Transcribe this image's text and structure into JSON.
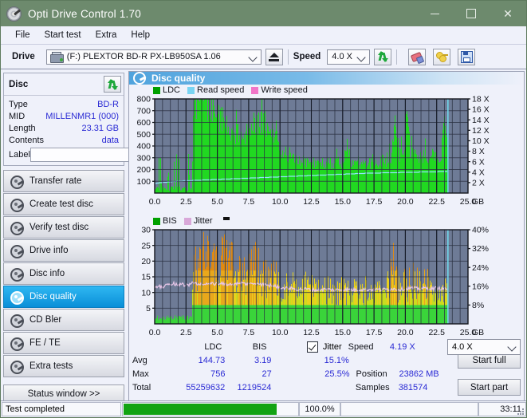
{
  "window": {
    "title": "Opti Drive Control 1.70",
    "icon": "disc-pen-icon",
    "minimize": "minimize-icon",
    "maximize": "maximize-icon",
    "close": "close-icon"
  },
  "menu": [
    "File",
    "Start test",
    "Extra",
    "Help"
  ],
  "toolbar": {
    "drive_label": "Drive",
    "drive_value": "(F:)  PLEXTOR BD-R  PX-LB950SA 1.06",
    "eject_icon": "eject-icon",
    "speed_label": "Speed",
    "speed_value": "4.0 X",
    "refresh_icon": "refresh-arrows-icon",
    "erase_icon": "eraser-icon",
    "keys_icon": "keys-icon",
    "save_icon": "save-floppy-icon"
  },
  "disc": {
    "title": "Disc",
    "refresh_icon": "refresh-arrows-icon",
    "rows": [
      {
        "key": "Type",
        "value": "BD-R"
      },
      {
        "key": "MID",
        "value": "MILLENMR1 (000)"
      },
      {
        "key": "Length",
        "value": "23.31 GB"
      },
      {
        "key": "Contents",
        "value": "data"
      }
    ],
    "label_key": "Label",
    "label_value": "",
    "label_placeholder": "",
    "label_icon": "cd-icon"
  },
  "nav": {
    "items": [
      {
        "label": "Transfer rate",
        "selected": false
      },
      {
        "label": "Create test disc",
        "selected": false
      },
      {
        "label": "Verify test disc",
        "selected": false
      },
      {
        "label": "Drive info",
        "selected": false
      },
      {
        "label": "Disc info",
        "selected": false
      },
      {
        "label": "Disc quality",
        "selected": true
      },
      {
        "label": "CD Bler",
        "selected": false
      },
      {
        "label": "FE / TE",
        "selected": false
      },
      {
        "label": "Extra tests",
        "selected": false
      }
    ],
    "status_window": "Status window >>"
  },
  "panel": {
    "title": "Disc quality",
    "icon": "disc-quality-icon"
  },
  "stats": {
    "col_ldc": "LDC",
    "col_bis": "BIS",
    "jitter_label": "Jitter",
    "jitter_checked": true,
    "rows": [
      {
        "label": "Avg",
        "ldc": "144.73",
        "bis": "3.19",
        "jitter": "15.1%"
      },
      {
        "label": "Max",
        "ldc": "756",
        "bis": "27",
        "jitter": "25.5%"
      },
      {
        "label": "Total",
        "ldc": "55259632",
        "bis": "1219524",
        "jitter": ""
      }
    ],
    "speed_key": "Speed",
    "speed_val": "4.19 X",
    "position_key": "Position",
    "position_val": "23862 MB",
    "samples_key": "Samples",
    "samples_val": "381574",
    "speed_select": "4.0 X",
    "start_full": "Start full",
    "start_part": "Start part"
  },
  "statusbar": {
    "message": "Test completed",
    "percent": "100.0%",
    "elapsed": "33:11"
  },
  "colors": {
    "ldc_green": "#21d821",
    "read_speed": "#79e0f2",
    "write_speed": "#f075c8",
    "bis_green": "#21d821",
    "jitter_pink": "#e0b8e0",
    "plot_bg": "#6e7b96",
    "grid": "#2a3142",
    "accent_blue": "#2a2ad4",
    "titlebar": "#6d8a6d",
    "selected": "#0a8fd8",
    "progress": "#12a312"
  },
  "chart_data": [
    {
      "type": "area",
      "title": "Disc quality - LDC / Read speed / Write speed",
      "xlabel": "GB",
      "ylabel": "LDC",
      "xlim": [
        0.0,
        25.0
      ],
      "ylim": [
        0,
        800
      ],
      "xticks": [
        "0.0",
        "2.5",
        "5.0",
        "7.5",
        "10.0",
        "12.5",
        "15.0",
        "17.5",
        "20.0",
        "22.5",
        "25.0"
      ],
      "yticks": [
        "100",
        "200",
        "300",
        "400",
        "500",
        "600",
        "700",
        "800"
      ],
      "y2label": "X",
      "y2lim": [
        0,
        18
      ],
      "y2ticks": [
        "2 X",
        "4 X",
        "6 X",
        "8 X",
        "10 X",
        "12 X",
        "14 X",
        "16 X",
        "18 X"
      ],
      "grid": true,
      "legend": [
        {
          "name": "LDC",
          "color": "#00a000"
        },
        {
          "name": "Read speed",
          "color": "#79d4f2"
        },
        {
          "name": "Write speed",
          "color": "#f075c8"
        }
      ],
      "data_end_gb": 23.4,
      "series": [
        {
          "name": "LDC",
          "color": "#21d821",
          "x": [
            0.0,
            0.15,
            0.3,
            0.5,
            0.7,
            0.9,
            1.1,
            1.3,
            1.5,
            1.7,
            1.9,
            2.1,
            2.3,
            2.5,
            2.7,
            2.9,
            3.05,
            3.2,
            3.4,
            3.6,
            3.8,
            4.0,
            4.2,
            4.4,
            4.6,
            4.8,
            5.0,
            5.2,
            5.4,
            5.6,
            5.8,
            6.0,
            6.2,
            6.4,
            6.6,
            6.8,
            7.0,
            7.2,
            7.5,
            7.8,
            8.1,
            8.4,
            8.7,
            9.0,
            9.3,
            9.6,
            9.9,
            10.2,
            10.5,
            10.8,
            11.1,
            11.4,
            11.7,
            12.0,
            12.3,
            12.6,
            12.9,
            13.2,
            13.5,
            13.8,
            14.1,
            14.4,
            14.7,
            15.0,
            15.3,
            15.6,
            15.9,
            16.2,
            16.5,
            16.8,
            17.1,
            17.4,
            17.7,
            18.0,
            18.3,
            18.6,
            18.9,
            19.2,
            19.5,
            19.8,
            20.1,
            20.4,
            20.7,
            21.0,
            21.3,
            21.6,
            21.9,
            22.2,
            22.5,
            22.8,
            23.1,
            23.4
          ],
          "values": [
            60,
            300,
            90,
            70,
            70,
            160,
            150,
            60,
            300,
            60,
            50,
            50,
            50,
            60,
            200,
            520,
            700,
            740,
            700,
            720,
            690,
            760,
            700,
            740,
            660,
            600,
            620,
            560,
            600,
            480,
            560,
            520,
            480,
            440,
            460,
            420,
            440,
            480,
            560,
            580,
            540,
            600,
            550,
            560,
            520,
            440,
            400,
            340,
            310,
            300,
            290,
            270,
            260,
            250,
            240,
            250,
            240,
            250,
            230,
            240,
            230,
            250,
            240,
            260,
            420,
            250,
            260,
            250,
            240,
            250,
            240,
            260,
            250,
            260,
            250,
            240,
            300,
            640,
            300,
            290,
            610,
            300,
            300,
            290,
            300,
            290,
            300,
            290,
            280,
            290,
            560,
            300
          ]
        },
        {
          "name": "Read speed",
          "color": "#8fe6f7",
          "x": [
            0.0,
            0.5,
            1.0,
            1.5,
            2.0,
            2.5,
            3.0,
            4.0,
            5.0,
            6.0,
            7.0,
            8.0,
            9.0,
            10.0,
            11.0,
            12.0,
            13.0,
            14.0,
            15.0,
            16.0,
            17.0,
            18.0,
            19.0,
            20.0,
            21.0,
            22.0,
            23.0,
            23.4
          ],
          "values": [
            1.8,
            2.0,
            2.1,
            2.2,
            2.3,
            2.35,
            2.4,
            2.5,
            2.6,
            2.7,
            2.8,
            2.9,
            3.0,
            3.1,
            3.2,
            3.3,
            3.4,
            3.5,
            3.6,
            3.7,
            3.8,
            3.85,
            3.9,
            3.95,
            4.0,
            4.05,
            4.1,
            4.15
          ]
        }
      ],
      "marker_line_gb": 23.4
    },
    {
      "type": "area",
      "title": "BIS / Jitter",
      "xlabel": "GB",
      "ylabel": "BIS",
      "xlim": [
        0.0,
        25.0
      ],
      "ylim": [
        0,
        30
      ],
      "xticks": [
        "0.0",
        "2.5",
        "5.0",
        "7.5",
        "10.0",
        "12.5",
        "15.0",
        "17.5",
        "20.0",
        "22.5",
        "25.0"
      ],
      "yticks": [
        "5",
        "10",
        "15",
        "20",
        "25",
        "30"
      ],
      "y2label": "%",
      "y2lim": [
        0,
        40
      ],
      "y2ticks": [
        "8%",
        "16%",
        "24%",
        "32%",
        "40%"
      ],
      "grid": true,
      "legend": [
        {
          "name": "BIS",
          "color": "#00a000"
        },
        {
          "name": "Jitter",
          "color": "#d9a8d9"
        }
      ],
      "data_end_gb": 23.4,
      "series": [
        {
          "name": "BIS",
          "color": "#21d821",
          "x": [
            0.0,
            0.3,
            0.6,
            0.9,
            1.2,
            1.5,
            1.8,
            2.1,
            2.4,
            2.7,
            2.95,
            3.1,
            3.3,
            3.6,
            3.9,
            4.2,
            4.5,
            4.8,
            5.1,
            5.4,
            5.7,
            6.0,
            6.3,
            6.6,
            6.9,
            7.2,
            7.5,
            7.8,
            8.1,
            8.4,
            8.7,
            9.0,
            9.3,
            9.6,
            9.9,
            10.2,
            10.5,
            10.8,
            11.1,
            11.4,
            11.7,
            12.0,
            12.5,
            13.0,
            13.5,
            14.0,
            14.5,
            15.0,
            15.5,
            16.0,
            16.5,
            17.0,
            17.5,
            18.0,
            18.5,
            19.0,
            19.4,
            19.8,
            20.2,
            20.6,
            21.0,
            21.4,
            21.8,
            22.2,
            22.6,
            23.0,
            23.4
          ],
          "values": [
            5,
            2,
            2,
            2,
            2,
            5,
            2,
            2,
            2,
            2,
            12,
            20,
            22,
            24,
            26,
            23,
            24,
            22,
            21,
            27,
            22,
            24,
            20,
            21,
            22,
            20,
            21,
            25,
            22,
            20,
            19,
            17,
            17,
            18,
            16,
            15,
            14,
            14,
            14,
            13,
            13,
            14,
            13,
            12,
            13,
            12,
            12,
            13,
            12,
            12,
            12,
            13,
            12,
            12,
            13,
            21,
            15,
            14,
            15,
            18,
            14,
            15,
            14,
            14,
            13,
            14,
            12
          ]
        },
        {
          "name": "Jitter",
          "color": "#e8c6e8",
          "x": [
            0.0,
            0.3,
            0.6,
            0.9,
            1.2,
            1.5,
            1.8,
            2.1,
            2.4,
            2.7,
            3.0,
            3.3,
            3.6,
            3.9,
            4.2,
            4.5,
            4.8,
            5.1,
            5.4,
            5.7,
            6.0,
            6.5,
            7.0,
            7.5,
            8.0,
            8.5,
            9.0,
            9.5,
            10.0,
            10.5,
            11.0,
            11.5,
            12.0,
            12.5,
            13.0,
            13.5,
            14.0,
            14.5,
            15.0,
            15.5,
            16.0,
            16.5,
            17.0,
            17.5,
            18.0,
            18.5,
            19.0,
            19.5,
            20.0,
            20.5,
            21.0,
            21.5,
            22.0,
            22.5,
            23.0,
            23.4
          ],
          "values": [
            11.5,
            12.0,
            11.6,
            12.6,
            12.2,
            13.0,
            12.4,
            12.8,
            12.4,
            12.2,
            13.0,
            12.8,
            12.6,
            12.9,
            12.7,
            12.8,
            12.6,
            12.9,
            12.7,
            12.5,
            12.8,
            12.6,
            12.9,
            12.7,
            12.9,
            12.6,
            12.4,
            12.2,
            11.6,
            11.4,
            11.2,
            11.0,
            11.1,
            10.9,
            10.8,
            11.0,
            10.9,
            10.8,
            11.0,
            10.9,
            10.8,
            11.0,
            10.9,
            11.0,
            10.9,
            11.0,
            11.2,
            11.0,
            11.2,
            11.4,
            11.2,
            11.4,
            11.2,
            11.4,
            11.2,
            11.3
          ]
        }
      ],
      "marker_line_gb": 23.4
    }
  ]
}
